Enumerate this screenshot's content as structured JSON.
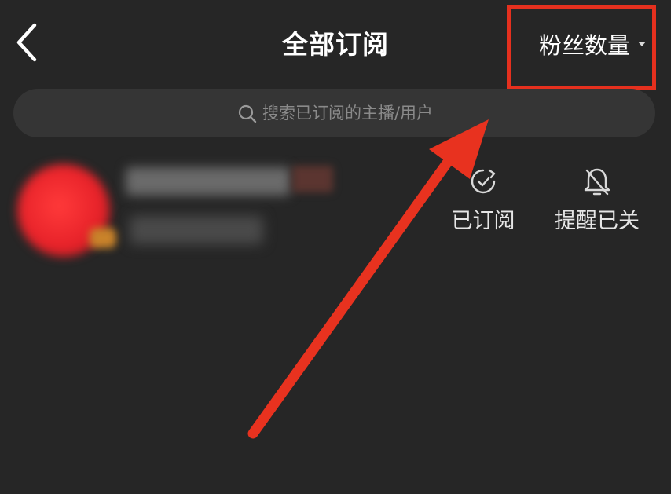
{
  "header": {
    "title": "全部订阅",
    "sort_label": "粉丝数量"
  },
  "search": {
    "placeholder": "搜索已订阅的主播/用户"
  },
  "subscriptions": [
    {
      "subscribed_label": "已订阅",
      "remind_label": "提醒已关"
    }
  ],
  "colors": {
    "background": "#262626",
    "search_bg": "#353535",
    "highlight": "#e5301e"
  },
  "icons": {
    "back": "chevron-left-icon",
    "search": "search-icon",
    "subscribed": "subscribed-check-icon",
    "remind_off": "bell-off-icon"
  }
}
